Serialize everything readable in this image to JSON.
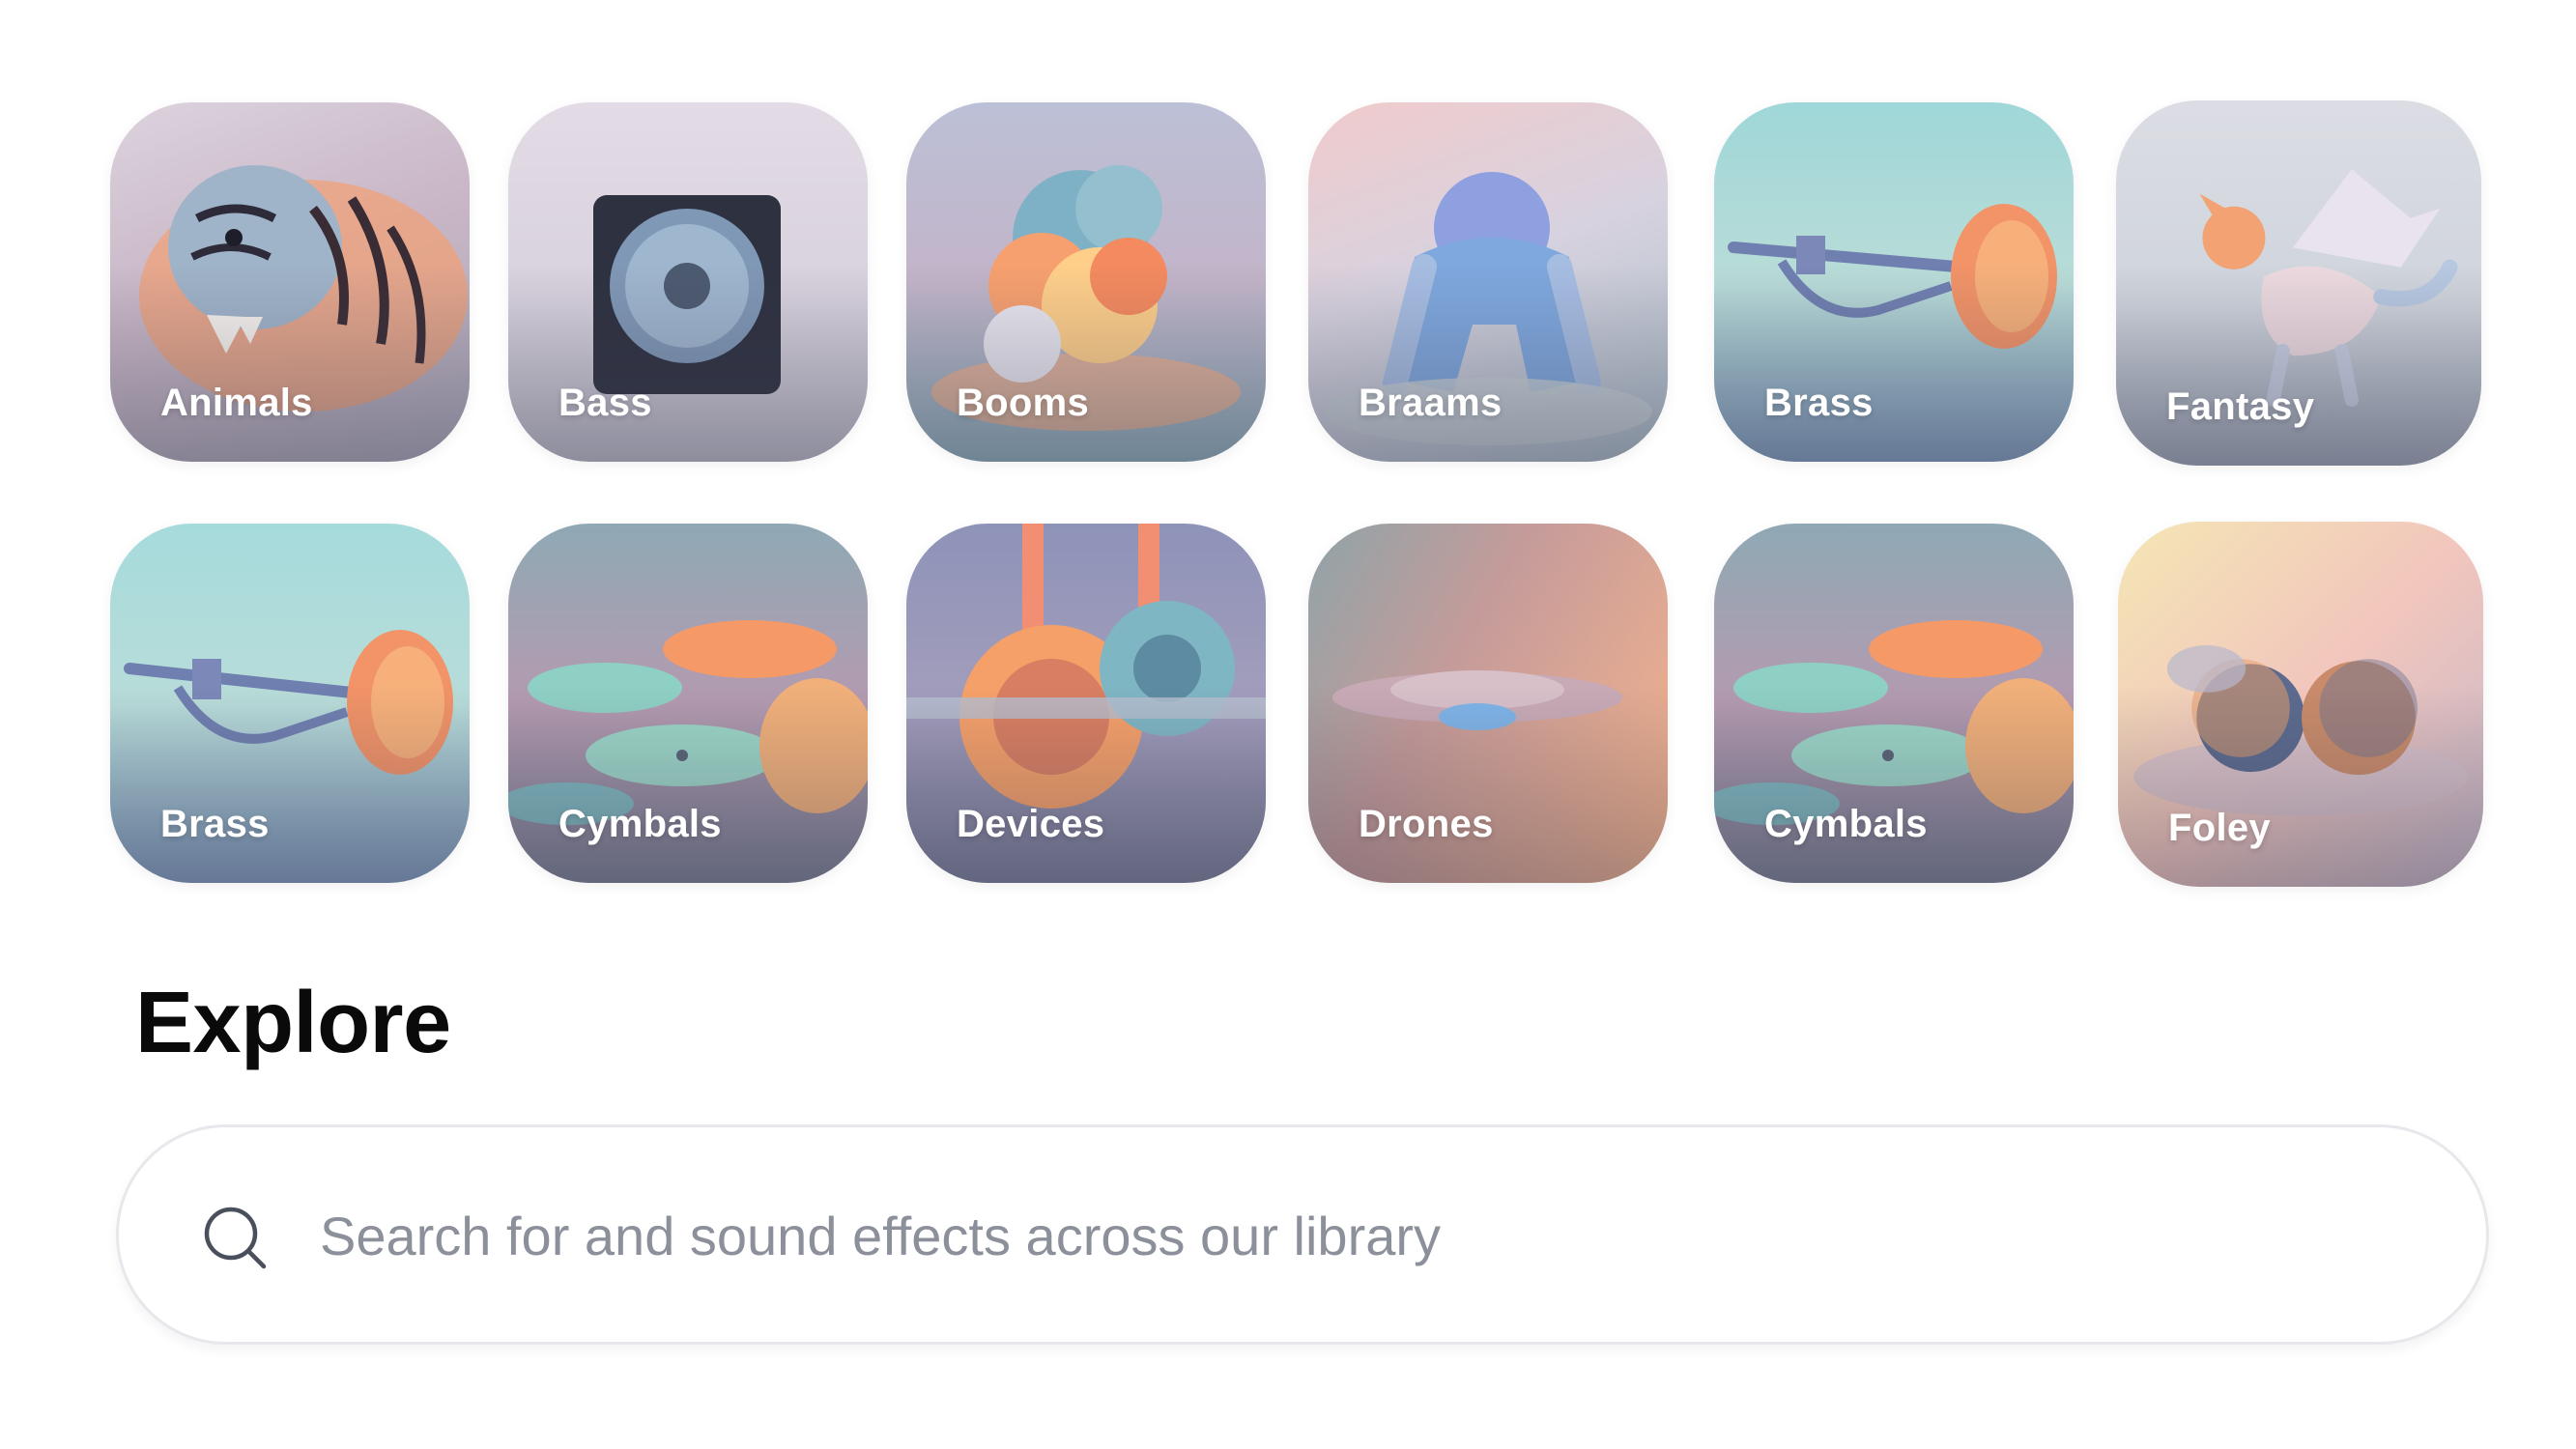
{
  "categories": {
    "row1": [
      {
        "label": "Animals",
        "icon": "tiger-icon"
      },
      {
        "label": "Bass",
        "icon": "speaker-icon"
      },
      {
        "label": "Booms",
        "icon": "explosion-icon"
      },
      {
        "label": "Braams",
        "icon": "monster-icon"
      },
      {
        "label": "Brass",
        "icon": "trumpet-icon"
      },
      {
        "label": "Fantasy",
        "icon": "dragon-icon"
      }
    ],
    "row2": [
      {
        "label": "Brass",
        "icon": "trumpet-icon"
      },
      {
        "label": "Cymbals",
        "icon": "cymbals-icon"
      },
      {
        "label": "Devices",
        "icon": "gears-icon"
      },
      {
        "label": "Drones",
        "icon": "ufo-icon"
      },
      {
        "label": "Cymbals",
        "icon": "cymbals-icon"
      },
      {
        "label": "Foley",
        "icon": "coconuts-icon"
      }
    ]
  },
  "explore": {
    "title": "Explore",
    "search_placeholder": "Search for and sound effects across our library",
    "search_value": ""
  },
  "colors": {
    "accent_orange": "#f79a6a",
    "accent_teal": "#8fd3d6",
    "accent_lavender": "#b9a8d6",
    "title_text": "#0a0a0a",
    "placeholder_text": "#8c909a"
  }
}
